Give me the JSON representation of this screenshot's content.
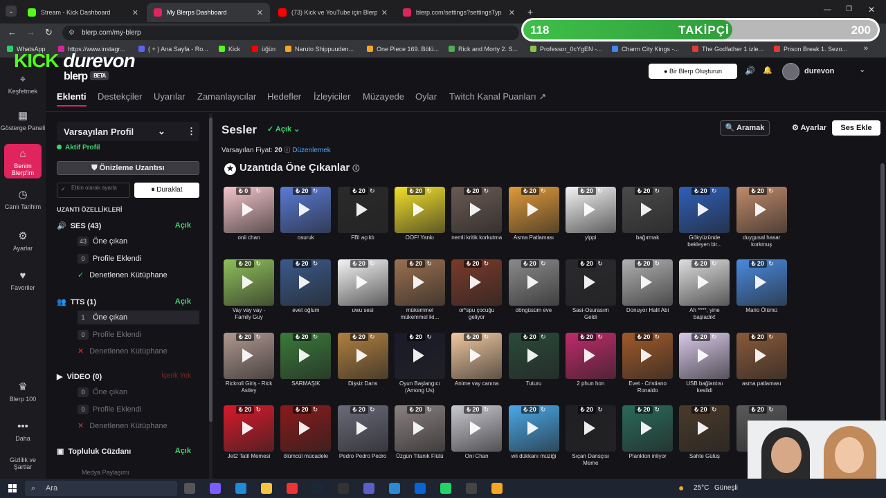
{
  "browser": {
    "tabs": [
      {
        "label": "Stream - Kick Dashboard",
        "color": "#53fc18",
        "active": false
      },
      {
        "label": "My Blerps Dashboard",
        "color": "#e0245e",
        "active": true
      },
      {
        "label": "(73) Kick ve YouTube için Blerp",
        "color": "#ff0000",
        "active": false
      },
      {
        "label": "blerp.com/settings?settingsTyp",
        "color": "#e0245e",
        "active": false
      }
    ],
    "url": "blerp.com/my-blerp",
    "bookmarks": [
      {
        "label": "WhatsApp",
        "color": "#25d366"
      },
      {
        "label": "https://www.instagr...",
        "color": "#d6249f"
      },
      {
        "label": "( + ) Ana Sayfa - Ro...",
        "color": "#5865f2"
      },
      {
        "label": "Kick",
        "color": "#53fc18"
      },
      {
        "label": "üğün",
        "color": "#ff0000"
      },
      {
        "label": "Naruto Shippuuden...",
        "color": "#f5a623"
      },
      {
        "label": "One Piece 169. Bölü...",
        "color": "#f5a623"
      },
      {
        "label": "Rick and Morty 2. S...",
        "color": "#4caf50"
      },
      {
        "label": "Professor_0cYgEN -...",
        "color": "#8bc34a"
      },
      {
        "label": "Charm City Kings -...",
        "color": "#4285f4"
      },
      {
        "label": "The Godfather 1 izle...",
        "color": "#e53935"
      },
      {
        "label": "Prison Break 1. Sezo...",
        "color": "#e53935"
      }
    ]
  },
  "overlay": {
    "logo": "kick",
    "username": "durevon",
    "followers_current": "118",
    "followers_label": "TAKİPÇİ",
    "followers_goal": "200",
    "progress": 0.59
  },
  "app": {
    "brand": "blerp",
    "beta": "BETA",
    "rail": [
      {
        "label": "Keşfetmek",
        "icon": "explore-icon"
      },
      {
        "label": "Gösterge Paneli",
        "icon": "dashboard-icon"
      },
      {
        "label": "Benim Blerp'im",
        "icon": "store-icon"
      },
      {
        "label": "Canlı Tarihim",
        "icon": "history-icon"
      },
      {
        "label": "Ayarlar",
        "icon": "gear-icon"
      },
      {
        "label": "Favoriler",
        "icon": "heart-icon"
      },
      {
        "label": "Blerp 100",
        "icon": "crown-icon"
      },
      {
        "label": "Daha",
        "icon": "more-icon"
      },
      {
        "label": "Gizlilik ve Şartlar",
        "icon": "doc-icon"
      }
    ],
    "create_button": "Bir Blerp Oluşturun",
    "user": "durevon",
    "nav": [
      "Eklenti",
      "Destekçiler",
      "Uyarılar",
      "Zamanlayıcılar",
      "Hedefler",
      "İzleyiciler",
      "Müzayede",
      "Oylar",
      "Twitch Kanal Puanları ↗"
    ]
  },
  "profile": {
    "name": "Varsayılan Profil",
    "status": "Aktif Profil",
    "preview_button": "Önizleme Uzantısı",
    "enabled_label": "Etkin olarak ayarla",
    "pause_button": "Duraklat",
    "features_label": "UZANTI ÖZELLİKLERİ",
    "sections": [
      {
        "title": "SES (43)",
        "state": "Açık",
        "items": [
          {
            "count": "43",
            "label": "Öne çıkan"
          },
          {
            "count": "0",
            "label": "Profile Eklendi"
          },
          {
            "count": "✓",
            "label": "Denetlenen Kütüphane"
          }
        ]
      },
      {
        "title": "TTS (1)",
        "state": "Açık",
        "items": [
          {
            "count": "1",
            "label": "Öne çıkan"
          },
          {
            "count": "0",
            "label": "Profile Eklendi"
          },
          {
            "count": "✕",
            "label": "Denetlenen Kütüphane"
          }
        ]
      },
      {
        "title": "VİDEO (0)",
        "state": "İçerik Yok",
        "items": [
          {
            "count": "0",
            "label": "Öne çıkan"
          },
          {
            "count": "0",
            "label": "Profile Eklendi"
          },
          {
            "count": "✕",
            "label": "Denetlenen Kütüphane"
          }
        ]
      },
      {
        "title": "Topluluk Cüzdanı",
        "state": "Açık",
        "items": []
      }
    ],
    "bottom_cut": "Medya Paylaşımı"
  },
  "main": {
    "title": "Sesler",
    "state": "Açık",
    "price_label": "Varsayılan Fiyat:",
    "price_value": "20",
    "edit_link": "Düzenlemek",
    "search_button": "Aramak",
    "settings_button": "Ayarlar",
    "add_button": "Ses Ekle",
    "featured_title": "Uzantıda Öne Çıkanlar",
    "tiles": [
      {
        "label": "onii chan",
        "price": "0",
        "bg": "#f3c4c9"
      },
      {
        "label": "osuruk",
        "price": "20",
        "bg": "#5a7bd6"
      },
      {
        "label": "FBI açıldı",
        "price": "20",
        "bg": "#2a2a2a"
      },
      {
        "label": "OOF! Yankı",
        "price": "20",
        "bg": "#f2e02a"
      },
      {
        "label": "nemli kritik korkutma",
        "price": "20",
        "bg": "#6a5a52"
      },
      {
        "label": "Asma Patlaması",
        "price": "20",
        "bg": "#e09a3a"
      },
      {
        "label": "yippi",
        "price": "20",
        "bg": "#f4f4f4"
      },
      {
        "label": "bağırmak",
        "price": "20",
        "bg": "#4a4a4a"
      },
      {
        "label": "Gökyüzünde bekleyen bir...",
        "price": "20",
        "bg": "#2f5fb8"
      },
      {
        "label": "duygusal hasar korkmuş",
        "price": "20",
        "bg": "#c08a6a"
      },
      {
        "label": "Vay vay vay - Family Guy",
        "price": "20",
        "bg": "#8fc05a"
      },
      {
        "label": "evet oğlum",
        "price": "20",
        "bg": "#3a5a8a"
      },
      {
        "label": "uwu sesi",
        "price": "20",
        "bg": "#f4f4f4"
      },
      {
        "label": "mükemmel mükemmel iki...",
        "price": "20",
        "bg": "#9a7050"
      },
      {
        "label": "or*spu çocuğu geliyor",
        "price": "20",
        "bg": "#7a3a2a"
      },
      {
        "label": "döngüsüm eve",
        "price": "20",
        "bg": "#8a8a8a"
      },
      {
        "label": "Sasi-Osurasım Geldi",
        "price": "20",
        "bg": "#2a2a2e"
      },
      {
        "label": "Donuyor Halil Abi",
        "price": "20",
        "bg": "#b0b0b0"
      },
      {
        "label": "Ah ****, yine başladık!",
        "price": "20",
        "bg": "#ddd"
      },
      {
        "label": "Mario Ölümü",
        "price": "20",
        "bg": "#4a8ade"
      },
      {
        "label": "Rickroll Giriş - Rick Astley",
        "price": "20",
        "bg": "#b09890"
      },
      {
        "label": "SARMAŞIK",
        "price": "20",
        "bg": "#3a7a3a"
      },
      {
        "label": "Dişsiz Dans",
        "price": "20",
        "bg": "#b08040"
      },
      {
        "label": "Oyun Başlangıcı (Among Us)",
        "price": "20",
        "bg": "#1a1a2a"
      },
      {
        "label": "Anime vay canına",
        "price": "20",
        "bg": "#f0c8a0"
      },
      {
        "label": "Tuturu",
        "price": "20",
        "bg": "#2a4a3a"
      },
      {
        "label": "2 phun hon",
        "price": "20",
        "bg": "#c02a6a"
      },
      {
        "label": "Evet - Cristiano Ronaldo",
        "price": "20",
        "bg": "#a05a2a"
      },
      {
        "label": "USB bağlantısı kesildi",
        "price": "20",
        "bg": "#d8c8e8"
      },
      {
        "label": "asma patlaması",
        "price": "20",
        "bg": "#8a5a3a"
      },
      {
        "label": "Jet2 Tatil Memesi",
        "price": "20",
        "bg": "#d81a2a"
      },
      {
        "label": "ölümcül mücadele",
        "price": "20",
        "bg": "#8a1a1a"
      },
      {
        "label": "Pedro Pedro Pedro",
        "price": "20",
        "bg": "#6a6a7a"
      },
      {
        "label": "Üzgün Titanik Flütü",
        "price": "20",
        "bg": "#8a8080"
      },
      {
        "label": "Oni Chan",
        "price": "20",
        "bg": "#c8c8d0"
      },
      {
        "label": "wii dükkanı müziği",
        "price": "20",
        "bg": "#4aa8e8"
      },
      {
        "label": "Sıçan Dansçısı Meme",
        "price": "20",
        "bg": "#202024"
      },
      {
        "label": "Plankton inliyor",
        "price": "20",
        "bg": "#2a6a5a"
      },
      {
        "label": "Sahte Gülüş",
        "price": "20",
        "bg": "#4a3a2a"
      },
      {
        "label": "",
        "price": "20",
        "bg": "#5a5a5a"
      }
    ]
  },
  "taskbar": {
    "search_placeholder": "Ara",
    "weather": "25°C",
    "weather_label": "Güneşli"
  }
}
